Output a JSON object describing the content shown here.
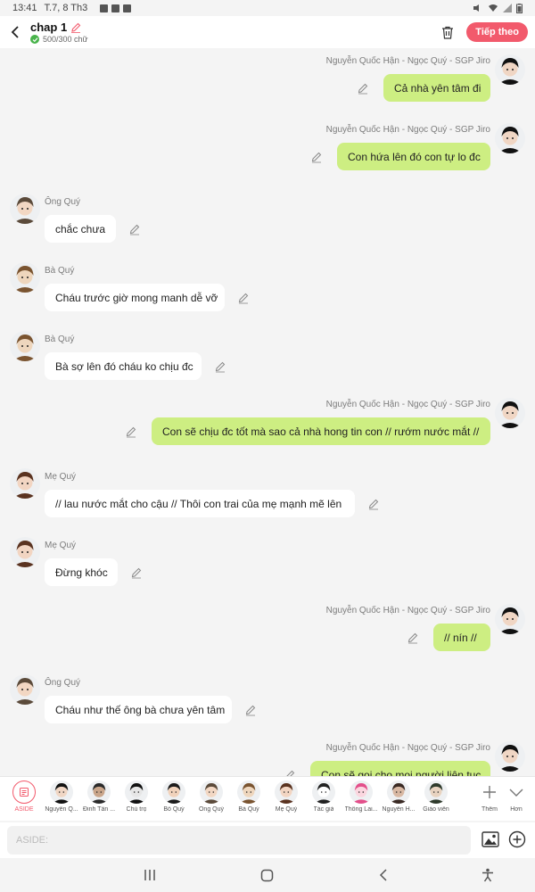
{
  "status": {
    "time": "13:41",
    "date": "T.7, 8 Th3"
  },
  "header": {
    "title": "chap 1",
    "word_count": "500/300 chữ",
    "next_label": "Tiếp theo"
  },
  "messages": [
    {
      "side": "right",
      "sender": "Nguyễn Quốc Hận - Ngọc Quý - SGP Jiro",
      "text": "Cả nhà yên tâm đi",
      "avatar": "black-haired-boy"
    },
    {
      "side": "right",
      "sender": "Nguyễn Quốc Hận - Ngọc Quý - SGP Jiro",
      "text": "Con hứa lên đó con tự lo đc",
      "avatar": "black-haired-boy"
    },
    {
      "side": "left",
      "sender": "Ông Quý",
      "text": "chắc chưa",
      "avatar": "old-man"
    },
    {
      "side": "left",
      "sender": "Bà Quý",
      "text": "Cháu trước giờ mong manh dễ vỡ",
      "avatar": "grandma"
    },
    {
      "side": "left",
      "sender": "Bà Quý",
      "text": "Bà sợ lên đó cháu ko chịu đc",
      "avatar": "grandma"
    },
    {
      "side": "right",
      "sender": "Nguyễn Quốc Hận - Ngọc Quý - SGP Jiro",
      "text": "Con sẽ chịu đc tốt mà sao cả nhà hong tin con // rướm nước mắt //",
      "avatar": "black-haired-boy"
    },
    {
      "side": "left",
      "sender": "Mẹ Quý",
      "text": "// lau nước mắt cho cậu // Thôi con trai của mẹ mạnh mẽ lên",
      "avatar": "mother"
    },
    {
      "side": "left",
      "sender": "Mẹ Quý",
      "text": "Đừng khóc",
      "avatar": "mother"
    },
    {
      "side": "right",
      "sender": "Nguyễn Quốc Hận - Ngọc Quý - SGP Jiro",
      "text": "// nín //",
      "avatar": "black-haired-boy"
    },
    {
      "side": "left",
      "sender": "Ông Quý",
      "text": "Cháu như thế ông bà chưa yên tâm",
      "avatar": "old-man"
    },
    {
      "side": "right",
      "sender": "Nguyễn Quốc Hận - Ngọc Quý - SGP Jiro",
      "text": "Con sẽ gọi cho mọi người liên tục",
      "avatar": "black-haired-boy"
    }
  ],
  "characters": [
    {
      "name": "ASIDE",
      "active": true
    },
    {
      "name": "Nguyễn Q...",
      "avatar": "black-haired-boy"
    },
    {
      "name": "Đinh Tấn ...",
      "avatar": "dark-boy"
    },
    {
      "name": "Chủ trọ",
      "avatar": "silhouette"
    },
    {
      "name": "Bố Quý",
      "avatar": "father"
    },
    {
      "name": "Ông Quý",
      "avatar": "old-man"
    },
    {
      "name": "Bà Quý",
      "avatar": "grandma"
    },
    {
      "name": "Mẹ Quý",
      "avatar": "mother"
    },
    {
      "name": "Tác giả",
      "avatar": "cat-author"
    },
    {
      "name": "Thông Lai...",
      "avatar": "pink-girl"
    },
    {
      "name": "Nguyễn H...",
      "avatar": "dark-girl"
    },
    {
      "name": "Giáo viên",
      "avatar": "teacher"
    }
  ],
  "tray_actions": {
    "more_label": "Thêm",
    "expand_label": "Hơn"
  },
  "composer": {
    "placeholder": "ASIDE:"
  },
  "colors": {
    "accent": "#f25a6c",
    "right_bubble": "#cdee82",
    "left_bubble": "#ffffff"
  }
}
